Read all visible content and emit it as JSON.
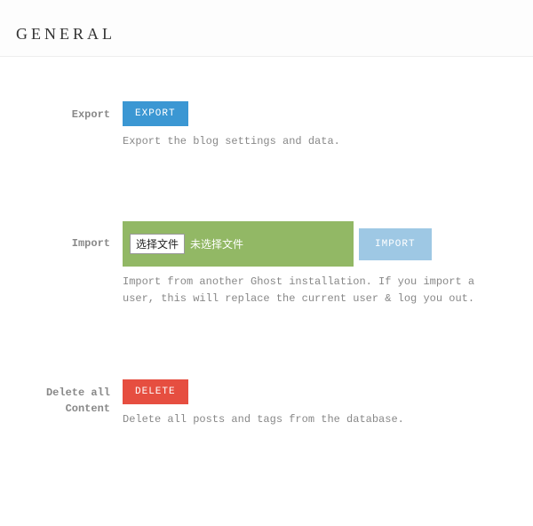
{
  "header": {
    "title": "GENERAL"
  },
  "export_section": {
    "label": "Export",
    "button": "EXPORT",
    "help": "Export the blog settings and data."
  },
  "import_section": {
    "label": "Import",
    "file_button": "选择文件",
    "file_status": "未选择文件",
    "button": "IMPORT",
    "help": "Import from another Ghost installation. If you import a user, this will replace the current user & log you out."
  },
  "delete_section": {
    "label": "Delete all Content",
    "button": "DELETE",
    "help": "Delete all posts and tags from the database."
  }
}
